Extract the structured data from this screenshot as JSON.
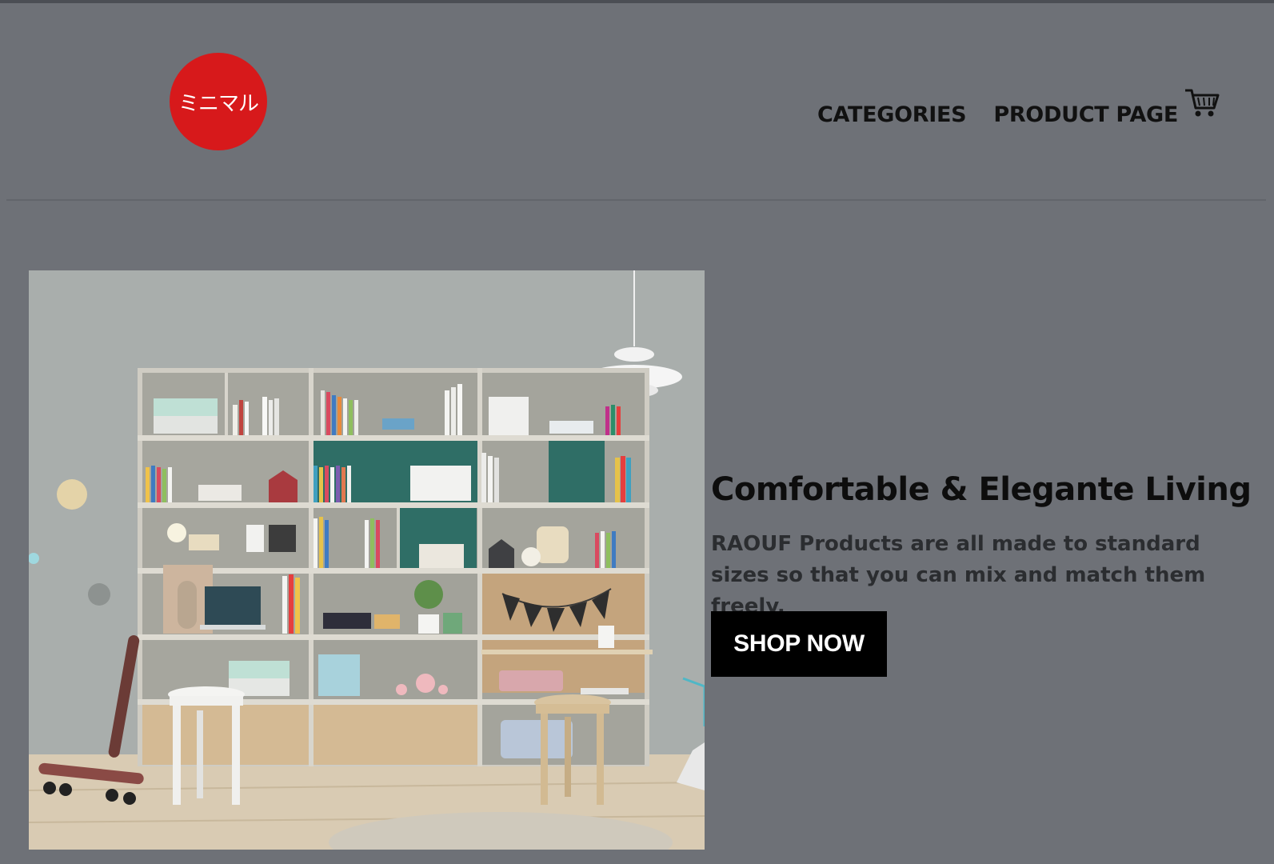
{
  "brand": {
    "logo_text": "ミニマル",
    "logo_color": "#d7191b"
  },
  "nav": {
    "items": [
      "CATEGORIES",
      "PRODUCT PAGE"
    ],
    "cart_icon": "shopping-cart-icon"
  },
  "hero": {
    "title": "Comfortable & Elegante Living",
    "description": "RAOUF Products are all made to standard sizes so that you can mix and match them freely.",
    "button_label": "SHOP NOW",
    "image_subject": "living room shelving"
  },
  "colors": {
    "background": "#6e7177",
    "button": "#000000",
    "button_text": "#ffffff"
  }
}
